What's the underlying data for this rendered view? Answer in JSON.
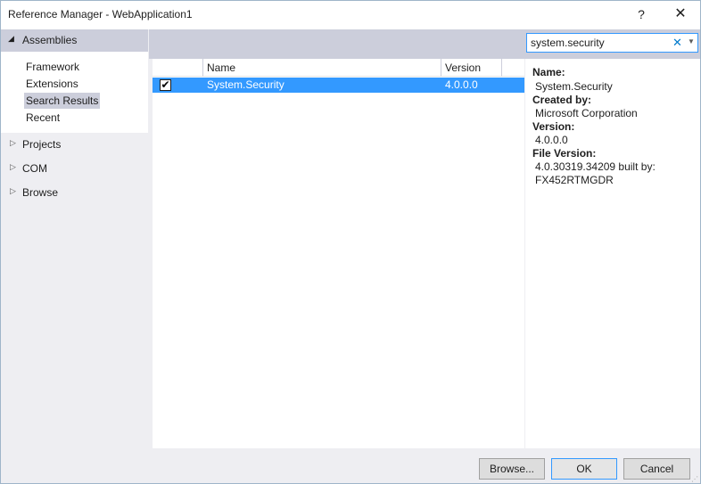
{
  "window": {
    "title": "Reference Manager - WebApplication1",
    "help_label": "?",
    "close_label": "✕"
  },
  "nav": {
    "section": {
      "label": "Assemblies",
      "arrow": "◢"
    },
    "sub_items": [
      "Framework",
      "Extensions",
      "Search Results",
      "Recent"
    ],
    "selected_sub_index": 2,
    "groups": [
      {
        "label": "Projects",
        "arrow": "▷"
      },
      {
        "label": "COM",
        "arrow": "▷"
      },
      {
        "label": "Browse",
        "arrow": "▷"
      }
    ]
  },
  "search": {
    "value": "system.security",
    "clear_icon": "✕",
    "dropdown_icon": "▼"
  },
  "grid": {
    "columns": [
      "Name",
      "Version"
    ],
    "rows": [
      {
        "checked": true,
        "check_glyph": "✔",
        "name": "System.Security",
        "version": "4.0.0.0",
        "selected": true
      }
    ]
  },
  "details": {
    "fields": [
      {
        "label": "Name:",
        "value": "System.Security"
      },
      {
        "label": "Created by:",
        "value": "Microsoft Corporation"
      },
      {
        "label": "Version:",
        "value": "4.0.0.0"
      },
      {
        "label": "File Version:",
        "value": "4.0.30319.34209 built by:"
      }
    ],
    "extra_line": "FX452RTMGDR"
  },
  "buttons": {
    "browse": "Browse...",
    "ok": "OK",
    "cancel": "Cancel"
  },
  "colors": {
    "selection": "#3399ff",
    "header_strip": "#cccedb",
    "clear_icon": "#007acc"
  }
}
